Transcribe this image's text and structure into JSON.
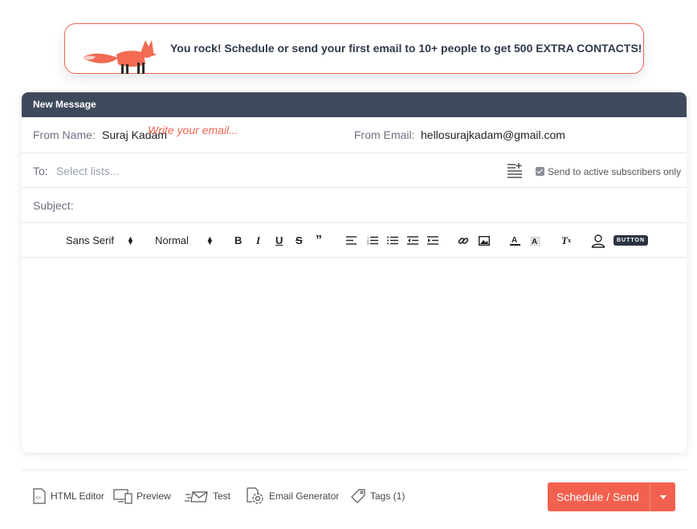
{
  "banner": {
    "message": "You rock! Schedule or send your first email to 10+ people to get 500 EXTRA CONTACTS!",
    "mascot_icon": "fox-icon",
    "border_color": "#f06552"
  },
  "compose": {
    "header_title": "New Message",
    "from_name_label": "From Name:",
    "from_name_value": "Suraj Kadam",
    "from_email_label": "From Email:",
    "from_email_value": "hellosurajkadam@gmail.com",
    "to_label": "To:",
    "to_placeholder": "Select lists...",
    "active_subscribers_label": "Send to active subscribers only",
    "active_subscribers_checked": true,
    "subject_label": "Subject:",
    "editor_placeholder": "Write your email..."
  },
  "toolbar": {
    "font_family": "Sans Serif",
    "font_size": "Normal",
    "button_tag": "BUTTON",
    "icons": [
      "bold-icon",
      "italic-icon",
      "underline-icon",
      "strike-icon",
      "quote-icon",
      "align-icon",
      "ordered-list-icon",
      "bullet-list-icon",
      "outdent-icon",
      "indent-icon",
      "link-icon",
      "image-icon",
      "font-color-icon",
      "background-color-icon",
      "clear-format-icon",
      "personalize-icon"
    ]
  },
  "footer": {
    "html_editor": "HTML Editor",
    "preview": "Preview",
    "test": "Test",
    "email_generator": "Email Generator",
    "tags": "Tags (1)",
    "send_button": "Schedule / Send"
  },
  "colors": {
    "accent": "#f2604f",
    "header_bg": "#3e4a5c"
  }
}
